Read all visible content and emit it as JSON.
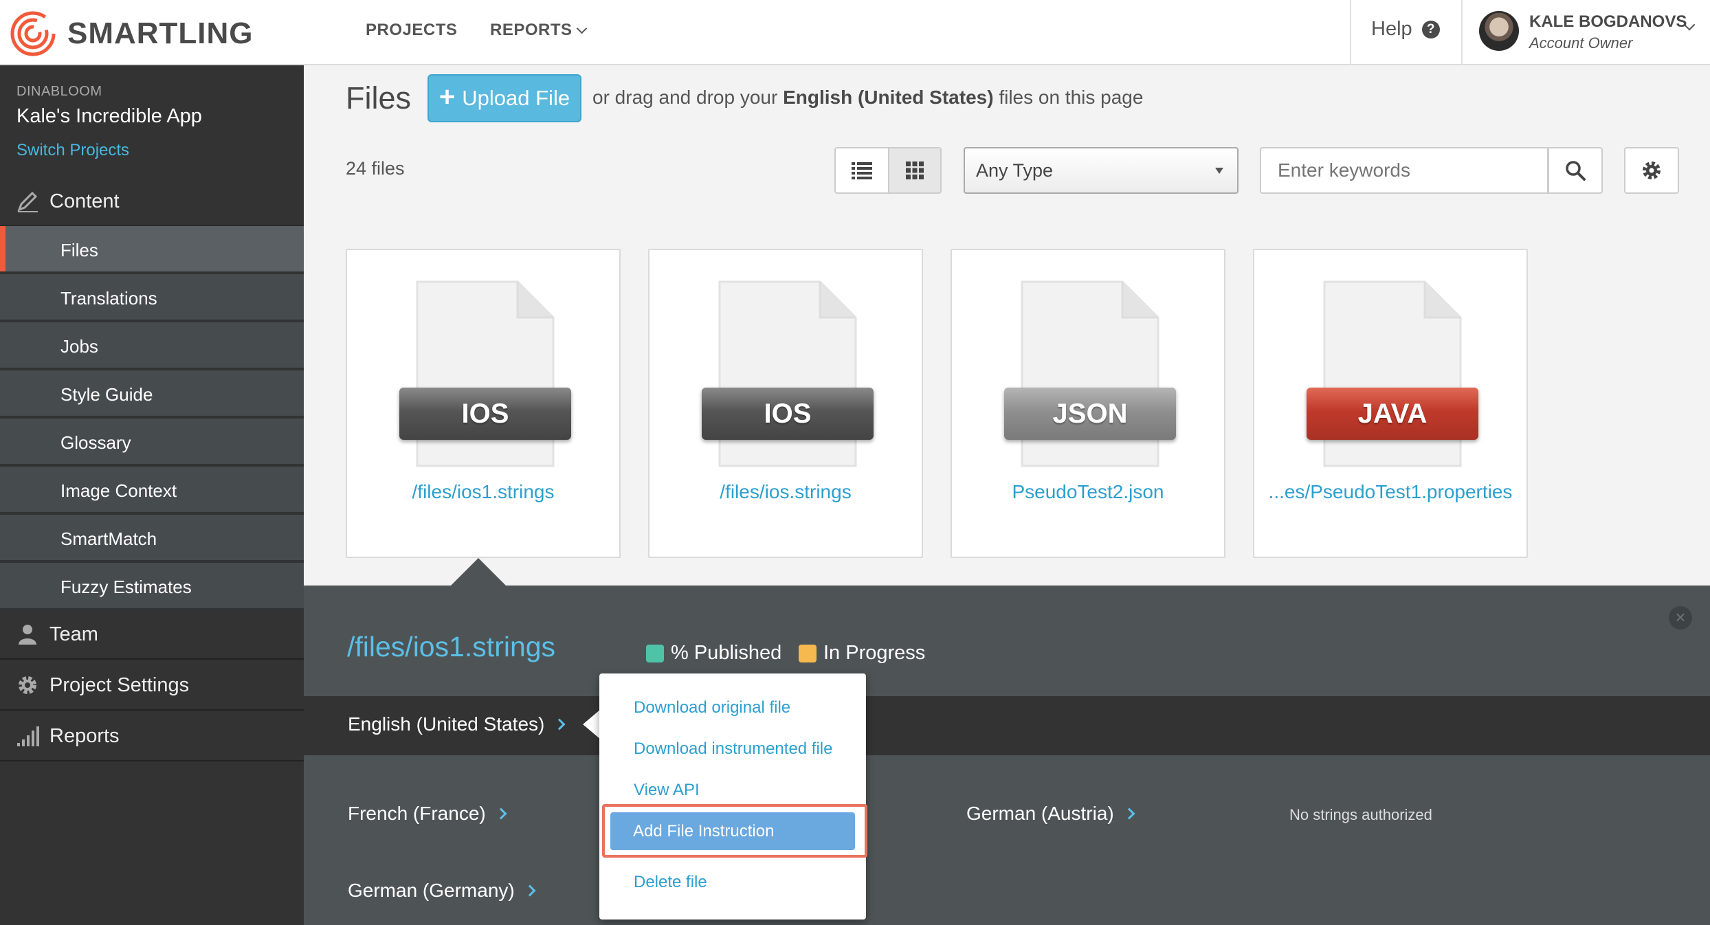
{
  "brand": {
    "name": "SMARTLING",
    "accent": "#f15a3a"
  },
  "top_nav": {
    "projects": "PROJECTS",
    "reports": "REPORTS",
    "help": "Help",
    "help_icon": "?"
  },
  "user": {
    "name": "KALE BOGDANOVS",
    "role": "Account Owner"
  },
  "sidebar": {
    "org": "DINABLOOM",
    "project": "Kale's Incredible App",
    "switch": "Switch Projects",
    "content_label": "Content",
    "items": [
      {
        "label": "Files"
      },
      {
        "label": "Translations"
      },
      {
        "label": "Jobs"
      },
      {
        "label": "Style Guide"
      },
      {
        "label": "Glossary"
      },
      {
        "label": "Image Context"
      },
      {
        "label": "SmartMatch"
      },
      {
        "label": "Fuzzy Estimates"
      }
    ],
    "team": "Team",
    "settings": "Project Settings",
    "reports": "Reports"
  },
  "header": {
    "title": "Files",
    "upload": "Upload File",
    "drag_pre": "or drag and drop your",
    "drag_lang": "English (United States)",
    "drag_post": "files on this page",
    "count": "24 files",
    "type_filter": "Any Type",
    "search_placeholder": "Enter keywords"
  },
  "files": [
    {
      "badge": "IOS",
      "name": "/files/ios1.strings"
    },
    {
      "badge": "IOS",
      "name": "/files/ios.strings"
    },
    {
      "badge": "JSON",
      "name": "PseudoTest2.json"
    },
    {
      "badge": "JAVA",
      "name": "...es/PseudoTest1.properties"
    }
  ],
  "detail": {
    "title": "/files/ios1.strings",
    "legend_published": "% Published",
    "legend_progress": "In Progress",
    "published_color": "#4fc3a8",
    "progress_color": "#f5b94f",
    "source_lang": "English (United States)",
    "languages": [
      "French (France)",
      "German (Austria)",
      "German (Germany)"
    ],
    "no_strings": "No strings authorized"
  },
  "menu": {
    "items": [
      "Download original file",
      "Download instrumented file",
      "View API",
      "Add File Instruction",
      "Delete file"
    ]
  }
}
